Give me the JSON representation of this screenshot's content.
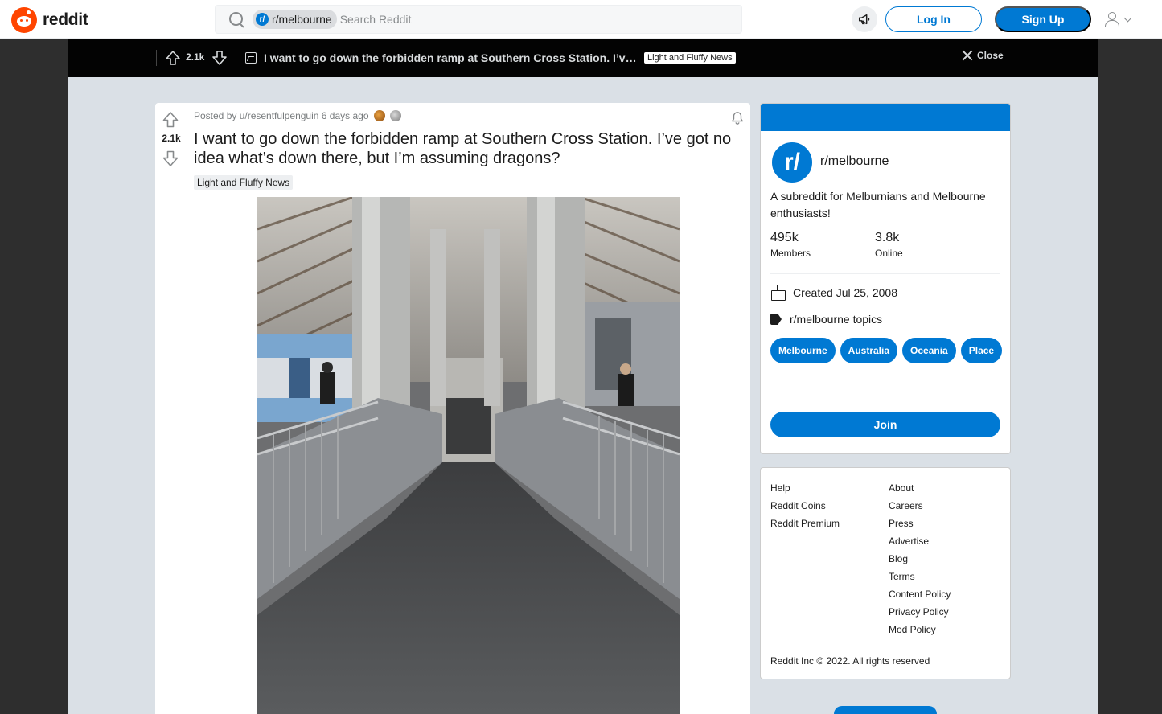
{
  "brand": {
    "name": "reddit"
  },
  "search": {
    "scope": "r/melbourne",
    "placeholder": "Search Reddit"
  },
  "header": {
    "login_label": "Log In",
    "signup_label": "Sign Up"
  },
  "topbar": {
    "score": "2.1k",
    "title": "I want to go down the forbidden ramp at Southern Cross Station. I’ve got no idea what’s down there, but I’m assuming dragons?",
    "flair": "Light and Fluffy News",
    "close_label": "Close"
  },
  "post": {
    "score": "2.1k",
    "meta": "Posted by u/resentfulpenguin 6 days ago",
    "title": "I want to go down the forbidden ramp at Southern Cross Station. I’ve got no idea what’s down there, but I’m assuming dragons?",
    "flair": "Light and Fluffy News"
  },
  "sidebar": {
    "avatar_text": "r/",
    "name": "r/melbourne",
    "description": "A subreddit for Melburnians and Melbourne enthusiasts!",
    "members": {
      "value": "495k",
      "label": "Members"
    },
    "online": {
      "value": "3.8k",
      "label": "Online"
    },
    "created": "Created Jul 25, 2008",
    "topics_label": "r/melbourne topics",
    "topics": [
      "Melbourne",
      "Australia",
      "Oceania",
      "Place"
    ],
    "join_label": "Join"
  },
  "footer": {
    "col1": [
      "Help",
      "Reddit Coins",
      "Reddit Premium"
    ],
    "col2": [
      "About",
      "Careers",
      "Press",
      "Advertise",
      "Blog",
      "Terms",
      "Content Policy",
      "Privacy Policy",
      "Mod Policy"
    ],
    "copyright": "Reddit Inc © 2022. All rights reserved"
  },
  "colors": {
    "accent": "#0079d3",
    "brand": "#ff4500",
    "backdrop": "#dae0e6",
    "topbar": "#030303"
  }
}
